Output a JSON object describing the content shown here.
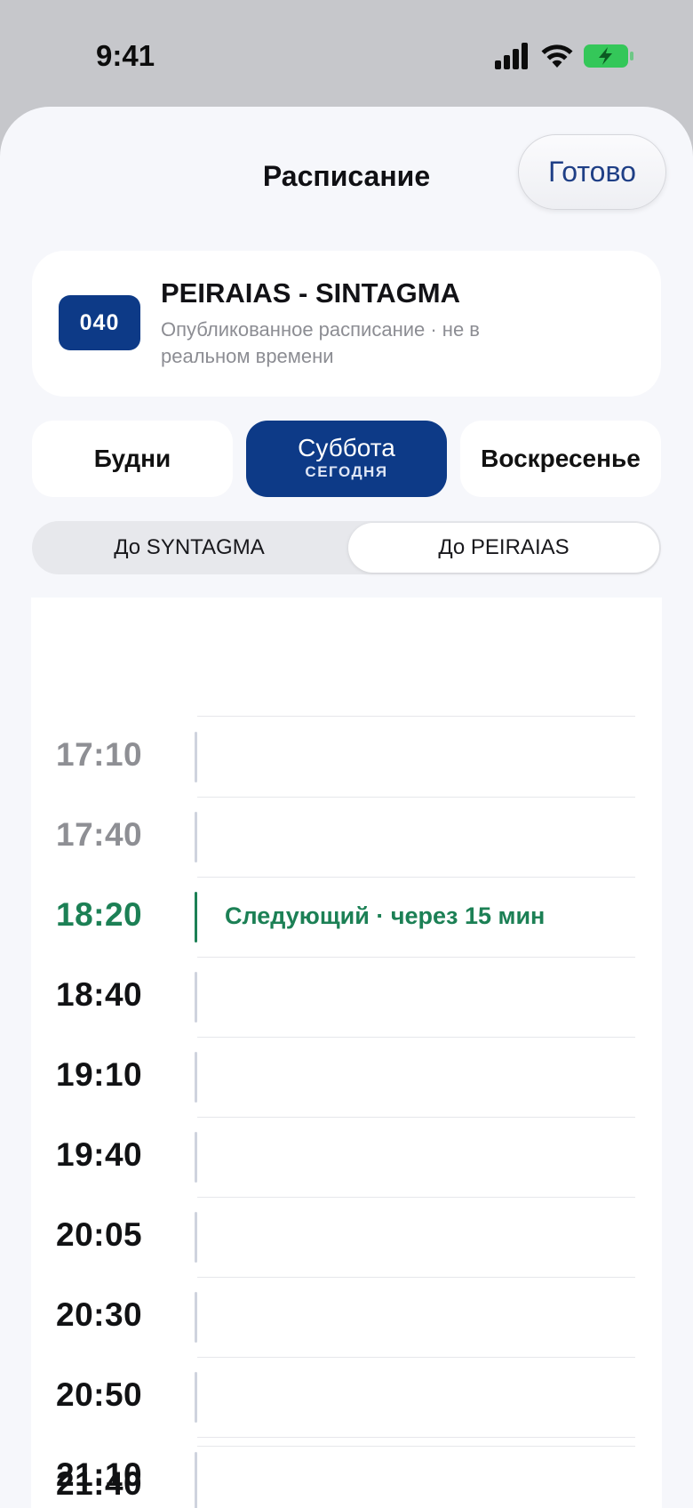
{
  "status": {
    "time": "9:41"
  },
  "header": {
    "title": "Расписание",
    "done_label": "Готово"
  },
  "route": {
    "number": "040",
    "name": "PEIRAIAS - SINTAGMA",
    "subtitle": "Опубликованное расписание · не в реальном времени"
  },
  "day_tabs": [
    {
      "label": "Будни"
    },
    {
      "label": "Суббота",
      "sub": "СЕГОДНЯ",
      "active": true
    },
    {
      "label": "Воскресенье"
    }
  ],
  "direction": {
    "options": [
      "До SYNTAGMA",
      "До PEIRAIAS"
    ],
    "selected": "До PEIRAIAS"
  },
  "departures": [
    {
      "time": "17:10",
      "state": "past"
    },
    {
      "time": "17:40",
      "state": "past"
    },
    {
      "time": "18:20",
      "state": "next",
      "note": "Следующий · через 15 мин"
    },
    {
      "time": "18:40"
    },
    {
      "time": "19:10"
    },
    {
      "time": "19:40"
    },
    {
      "time": "20:05"
    },
    {
      "time": "20:30"
    },
    {
      "time": "20:50"
    },
    {
      "time": "21:10"
    },
    {
      "time": "21:40"
    }
  ],
  "colors": {
    "accent": "#0d3a87",
    "next": "#1c8055",
    "done_text": "#1f3f86",
    "battery": "#34c759"
  }
}
